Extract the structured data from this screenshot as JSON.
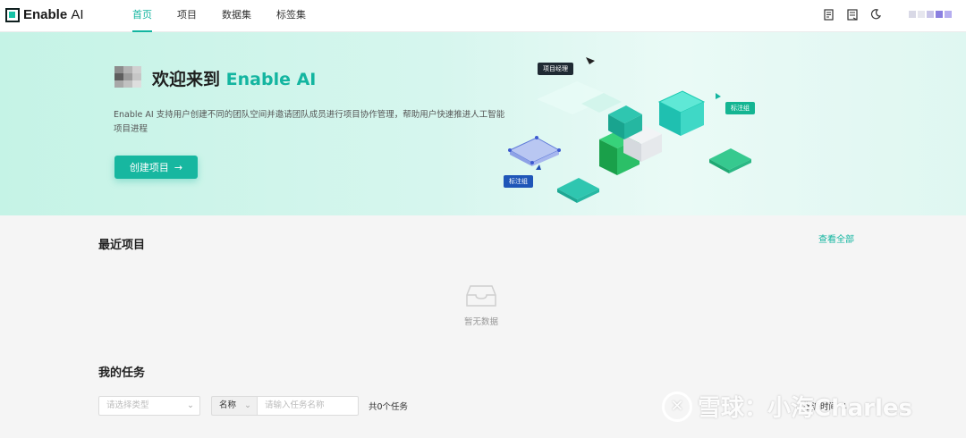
{
  "app": {
    "name_main": "Enable",
    "name_ai": "AI"
  },
  "nav": [
    {
      "label": "首页",
      "active": true
    },
    {
      "label": "项目",
      "active": false
    },
    {
      "label": "数据集",
      "active": false
    },
    {
      "label": "标签集",
      "active": false
    }
  ],
  "top_icons": [
    "notes-icon",
    "document-icon",
    "moon-icon"
  ],
  "hero": {
    "title_prefix": "欢迎来到",
    "title_brand": "Enable AI",
    "description": "Enable AI 支持用户创建不同的团队空间并邀请团队成员进行项目协作管理，帮助用户快速推进人工智能项目进程",
    "create_button": "创建项目",
    "art_tags": {
      "manager": "项目经理",
      "annotator_right": "标注组",
      "annotator_left": "标注组"
    }
  },
  "recent_projects": {
    "title": "最近项目",
    "view_all": "查看全部",
    "empty_text": "暂无数据"
  },
  "my_tasks": {
    "title": "我的任务",
    "type_placeholder": "请选择类型",
    "name_select": "名称",
    "search_placeholder": "请输入任务名称",
    "count_text": "共0个任务",
    "sort_label": "指派时间"
  },
  "watermark": {
    "text": "雪球：小海Charles"
  },
  "colors": {
    "accent": "#13b5a0",
    "hero_bg": "#c5f3e6"
  }
}
